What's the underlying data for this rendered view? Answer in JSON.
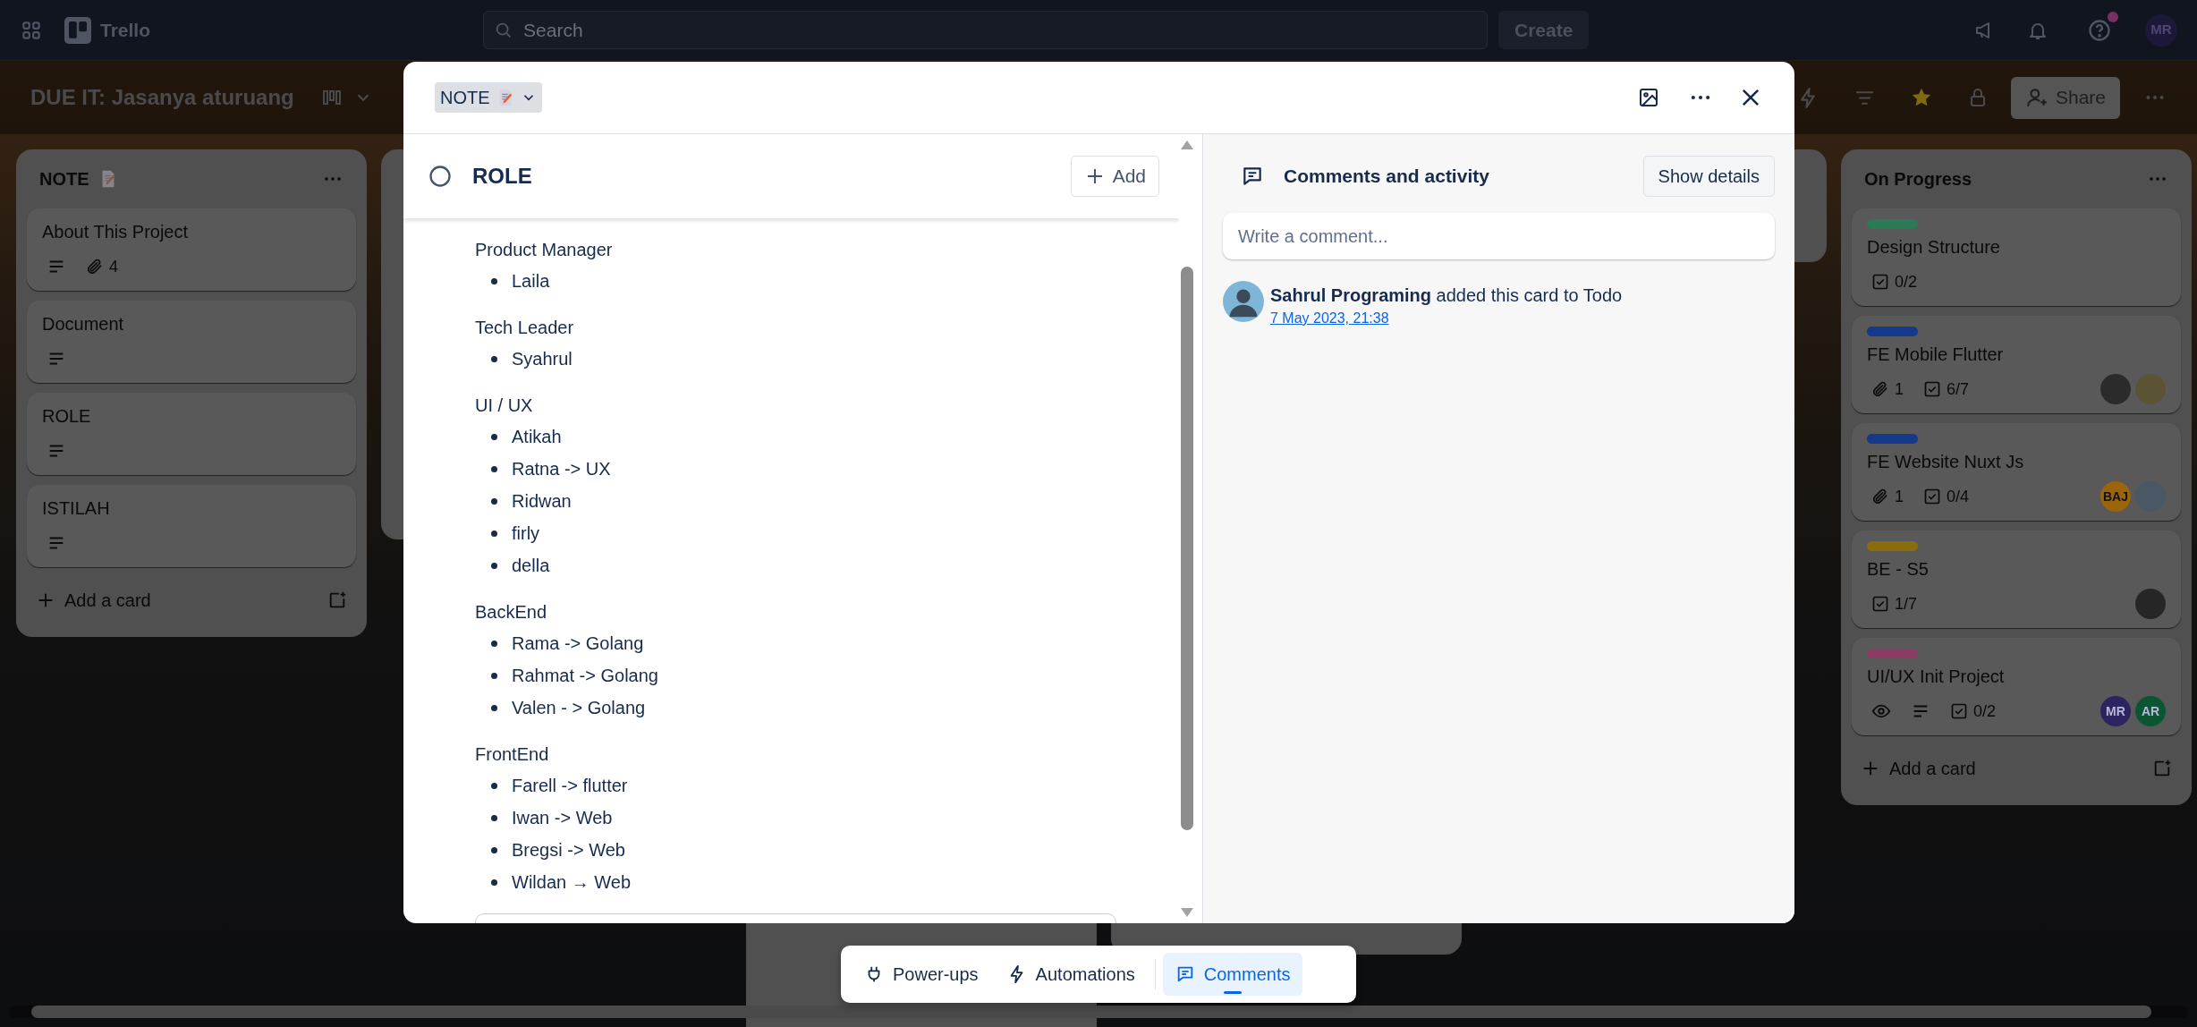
{
  "top_bar": {
    "logo": "Trello",
    "search_placeholder": "Search",
    "create_button": "Create",
    "help_notification": true,
    "avatar": "MR"
  },
  "board_header": {
    "title": "DUE IT: Jasanya aturuang",
    "starred": true,
    "share_button": "Share"
  },
  "lists": [
    {
      "title": "NOTE",
      "has_memo_icon": true,
      "add_card": "Add a card",
      "cards": [
        {
          "title": "About This Project",
          "description": true,
          "watching": false,
          "attachments": "4"
        },
        {
          "title": "Document",
          "description": true,
          "watching": false
        },
        {
          "title": "ROLE",
          "description": true,
          "watching": false
        },
        {
          "title": "ISTILAH",
          "description": true,
          "watching": false
        }
      ]
    },
    {
      "title": "On Progress",
      "has_memo_icon": false,
      "add_card": "Add a card",
      "cards": [
        {
          "color": "#2a7a57",
          "title": "Design Structure",
          "description": false,
          "watching": false,
          "checklist": "0/2"
        },
        {
          "color": "#14388a",
          "title": "FE Mobile Flutter",
          "description": false,
          "watching": false,
          "attachments": "1",
          "checklist": "6/7",
          "members": [
            {
              "kind": "photo",
              "color": "#2b2b2b"
            },
            {
              "kind": "photo",
              "color": "#5a5434"
            }
          ]
        },
        {
          "color": "#14388a",
          "title": "FE Website Nuxt Js",
          "description": false,
          "watching": false,
          "attachments": "1",
          "checklist": "0/4",
          "members": [
            {
              "kind": "initials",
              "initials": "BAJ",
              "color": "#9c650c"
            },
            {
              "kind": "photo",
              "color": "#4a5866"
            }
          ]
        },
        {
          "color": "#8a6c0e",
          "title": "BE - S5",
          "description": false,
          "watching": false,
          "checklist": "1/7",
          "members": [
            {
              "kind": "photo",
              "color": "#262626"
            }
          ]
        },
        {
          "color": "#8c3c64",
          "title": "UI/UX Init Project",
          "description": true,
          "watching": true,
          "checklist": "0/2",
          "members": [
            {
              "kind": "initials",
              "initials": "MR",
              "color": "#2c2460"
            },
            {
              "kind": "initials",
              "initials": "AR",
              "color": "#0b5532"
            }
          ]
        }
      ]
    }
  ],
  "card_modal": {
    "list_button": "NOTE",
    "title": "ROLE",
    "completed": false,
    "add_button": "Add",
    "description": [
      {
        "heading": "Product Manager",
        "items": [
          "Laila"
        ]
      },
      {
        "heading": "Tech Leader",
        "items": [
          "Syahrul"
        ]
      },
      {
        "heading": "UI / UX",
        "items": [
          "Atikah",
          "Ratna -> UX",
          "Ridwan",
          "firly",
          "della"
        ]
      },
      {
        "heading": "BackEnd",
        "items": [
          "Rama -> Golang",
          "Rahmat -> Golang",
          "Valen - > Golang"
        ]
      },
      {
        "heading": "FrontEnd",
        "items": [
          "Farell -> flutter",
          "Iwan -> Web",
          "Bregsi -> Web",
          "Wildan → Web"
        ]
      }
    ],
    "comments": {
      "title": "Comments and activity",
      "show_details_button": "Show details",
      "placeholder": "Write a comment...",
      "activity": [
        {
          "text": "**Sahrul Programing** added this card to Todo",
          "time": "7 May 2023, 21:38"
        }
      ]
    }
  },
  "bottom_bar": [
    {
      "label": "Power-ups",
      "selected": false
    },
    {
      "label": "Automations",
      "selected": false
    },
    {
      "label": "Comments",
      "selected": true
    }
  ]
}
